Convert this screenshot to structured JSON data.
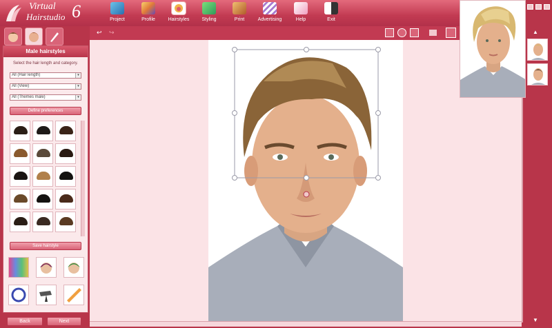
{
  "app": {
    "logo_line1": "Virtual",
    "logo_line2": "Hairstudio",
    "logo_version": "6"
  },
  "toolbar": {
    "items": [
      {
        "label": "Project",
        "icon": "project-icon"
      },
      {
        "label": "Profile",
        "icon": "profile-icon"
      },
      {
        "label": "Hairstyles",
        "icon": "hairstyles-icon",
        "active": true
      },
      {
        "label": "Styling",
        "icon": "styling-icon"
      },
      {
        "label": "Print",
        "icon": "print-icon"
      },
      {
        "label": "Advertising",
        "icon": "advertising-icon"
      },
      {
        "label": "Help",
        "icon": "help-icon"
      },
      {
        "label": "Exit",
        "icon": "exit-icon"
      }
    ]
  },
  "left_panel": {
    "title": "Male hairstyles",
    "instruction": "Select the hair length and category.",
    "filter_length": "All (Hair length)",
    "filter_view": "All (View)",
    "filter_theme": "All (Themes male)",
    "define_button": "Define preferences",
    "save_button": "Save hairstyle",
    "back_button": "Back",
    "next_button": "Next"
  },
  "colors": {
    "accent": "#c23a52",
    "panel_bg": "#fbe9eb",
    "canvas_bg": "#fbe3e6"
  }
}
